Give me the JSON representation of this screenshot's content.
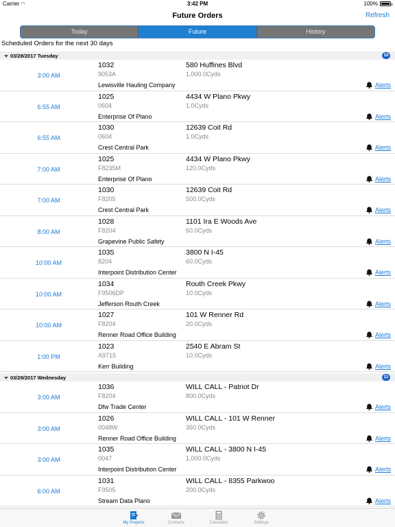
{
  "status_bar": {
    "carrier": "Carrier",
    "time": "3:42 PM",
    "battery": "100%"
  },
  "nav": {
    "title": "Future Orders",
    "refresh_label": "Refresh"
  },
  "tabs": [
    {
      "label": "Today",
      "active": false
    },
    {
      "label": "Future",
      "active": true
    },
    {
      "label": "History",
      "active": false
    }
  ],
  "subheader": "Scheduled Orders for the next 30 days",
  "days": [
    {
      "label": "03/28/2017 Tuesday",
      "count": "10",
      "orders": [
        {
          "time": "3:00 AM",
          "number": "1032",
          "code": "9053A",
          "address": "580 Huffines Blvd",
          "qty": "1,000.0Cyds",
          "site": "Lewisville Hauling Company",
          "alerts": "Alerts"
        },
        {
          "time": "6:55 AM",
          "number": "1025",
          "code": "0604",
          "address": "4434 W Plano Pkwy",
          "qty": "1.0Cyds",
          "site": "Enterprise Of Plano",
          "alerts": "Alerts"
        },
        {
          "time": "6:55 AM",
          "number": "1030",
          "code": "0604",
          "address": "12639 Coit Rd",
          "qty": "1.0Cyds",
          "site": "Crest Central Park",
          "alerts": "Alerts"
        },
        {
          "time": "7:00 AM",
          "number": "1025",
          "code": "F8235M",
          "address": "4434 W Plano Pkwy",
          "qty": "120.0Cyds",
          "site": "Enterprise Of Plano",
          "alerts": "Alerts"
        },
        {
          "time": "7:00 AM",
          "number": "1030",
          "code": "F8205",
          "address": "12639 Coit Rd",
          "qty": "500.0Cyds",
          "site": "Crest Central Park",
          "alerts": "Alerts"
        },
        {
          "time": "8:00 AM",
          "number": "1028",
          "code": "F8204",
          "address": "1101 Ira E Woods Ave",
          "qty": "60.0Cyds",
          "site": "Grapevine Public Safety",
          "alerts": "Alerts"
        },
        {
          "time": "10:00 AM",
          "number": "1035",
          "code": "8204",
          "address": "3800 N I-45",
          "qty": "60.0Cyds",
          "site": "Interpoint Distribution Center",
          "alerts": "Alerts"
        },
        {
          "time": "10:00 AM",
          "number": "1034",
          "code": "F9506DP",
          "address": "Routh Creek Pkwy",
          "qty": "10.0Cyds",
          "site": "Jefferson Routh Creek",
          "alerts": "Alerts"
        },
        {
          "time": "10:00 AM",
          "number": "1027",
          "code": "F8204",
          "address": "101 W Renner Rd",
          "qty": "20.0Cyds",
          "site": "Renner Road Office Building",
          "alerts": "Alerts"
        },
        {
          "time": "1:00 PM",
          "number": "1023",
          "code": "A9715",
          "address": "2540 E Abram St",
          "qty": "10.0Cyds",
          "site": "Kerr Building",
          "alerts": "Alerts"
        }
      ]
    },
    {
      "label": "03/29/2017 Wednesday",
      "count": "11",
      "orders": [
        {
          "time": "3:00 AM",
          "number": "1036",
          "code": "F8204",
          "address": "WILL CALL - Patriot Dr",
          "qty": "800.0Cyds",
          "site": "Dfw Trade Center",
          "alerts": "Alerts"
        },
        {
          "time": "3:00 AM",
          "number": "1026",
          "code": "0048W",
          "address": "WILL CALL - 101 W Renner",
          "qty": "350.0Cyds",
          "site": "Renner Road Office Building",
          "alerts": "Alerts"
        },
        {
          "time": "3:00 AM",
          "number": "1035",
          "code": "0047",
          "address": "WILL CALL - 3800 N I-45",
          "qty": "1,000.0Cyds",
          "site": "Interpoint Distribution Center",
          "alerts": "Alerts"
        },
        {
          "time": "6:00 AM",
          "number": "1031",
          "code": "F9505",
          "address": "WILL CALL - 8355 Parkwoo",
          "qty": "200.0Cyds",
          "site": "Stream Data Plano",
          "alerts": "Alerts"
        }
      ]
    }
  ],
  "tab_bar": [
    {
      "label": "My Projects",
      "icon": "projects-icon",
      "active": true
    },
    {
      "label": "Contacts",
      "icon": "envelope-icon",
      "active": false
    },
    {
      "label": "Calculator",
      "icon": "calculator-icon",
      "active": false
    },
    {
      "label": "Settings",
      "icon": "gear-icon",
      "active": false
    }
  ],
  "colors": {
    "accent": "#1a7ad6",
    "segment_active": "#1f7fd1",
    "segment_inactive": "#757575",
    "badge": "#1f62c5"
  }
}
